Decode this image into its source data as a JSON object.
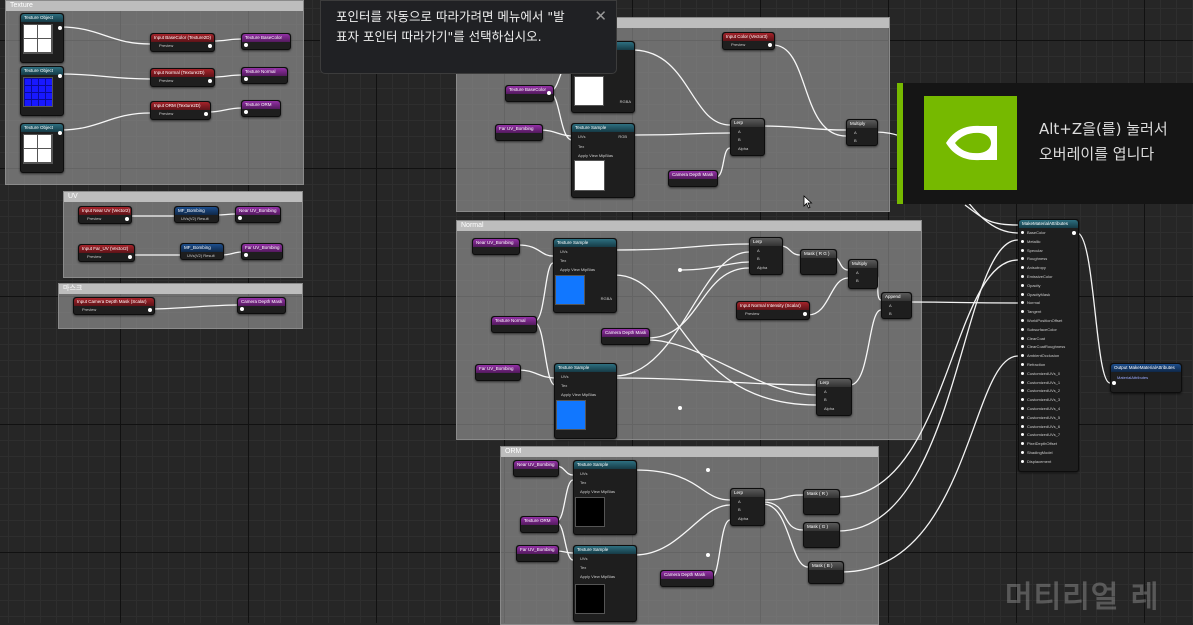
{
  "tooltip": {
    "line1": "포인터를 자동으로 따라가려면 메뉴에서 \"발",
    "line2": "표자 포인터 따라가기\"를 선택하십시오.",
    "close_label": "✕"
  },
  "overlay": {
    "line1": "Alt+Z을(를) 눌러서",
    "line2": "오버레이를 엽니다",
    "accent": "#76b900"
  },
  "watermark": "머티리얼 레",
  "comments": {
    "texture": "Texture",
    "uv": "UV",
    "mask": "마스크",
    "normal": "Normal",
    "orm": "ORM"
  },
  "nodes": {
    "tobj1": {
      "title": "Texture Object"
    },
    "tobj2": {
      "title": "Texture Object"
    },
    "tobj3": {
      "title": "Texture Object"
    },
    "in_basecolor": {
      "title": "Input BaseColor (Texture2D)",
      "pin": "Preview"
    },
    "in_normal": {
      "title": "Input Normal (Texture2D)",
      "pin": "Preview"
    },
    "in_orm": {
      "title": "Input ORM (Texture2D)",
      "pin": "Preview"
    },
    "out_basecolor": {
      "title": "Texture BaseColor"
    },
    "out_normal": {
      "title": "Texture Normal"
    },
    "out_orm": {
      "title": "Texture ORM"
    },
    "in_near_uv": {
      "title": "Input Near UV (Vector2)",
      "pin": "Preview"
    },
    "in_far_uv": {
      "title": "Input Far_UV (Vector2)",
      "pin": "Preview"
    },
    "uvb1": {
      "title": "MF_Bombing",
      "pin": "UVs(V2) Result"
    },
    "uvb2": {
      "title": "MF_Bombing",
      "pin": "UVs(V2) Result"
    },
    "out_near_uv": {
      "title": "Near UV_Bombing"
    },
    "out_far_uv": {
      "title": "Far UV_Bombing"
    },
    "in_cam_mask": {
      "title": "Input Camera Depth Mask (Scalar)",
      "pin": "Preview"
    },
    "out_cam_mask": {
      "title": "Camera Depth Mask"
    },
    "base_tex_basecolor": {
      "title": "Texture BaseColor"
    },
    "base_far_uv": {
      "title": "Far UV_Bombing"
    },
    "base_ts2": {
      "title": "Texture Sample"
    },
    "base_in_color": {
      "title": "Input Color (Vector3)",
      "pin": "Preview"
    },
    "base_lerp": {
      "title": "Lerp"
    },
    "base_multiply": {
      "title": "Multiply"
    },
    "base_cam_mask": {
      "title": "Camera Depth Mask"
    },
    "n_near_uv": {
      "title": "Near UV_Bombing"
    },
    "n_ts1": {
      "title": "Texture Sample"
    },
    "n_tex_normal": {
      "title": "Texture Normal"
    },
    "n_far_uv": {
      "title": "Far UV_Bombing"
    },
    "n_ts2": {
      "title": "Texture Sample"
    },
    "n_cam_mask": {
      "title": "Camera Depth Mask"
    },
    "n_lerp1": {
      "title": "Lerp"
    },
    "n_mask": {
      "title": "Mask ( R G )"
    },
    "n_multiply": {
      "title": "Multiply"
    },
    "n_intensity": {
      "title": "Input Normal Intensity (Scalar)",
      "pin": "Preview"
    },
    "n_append": {
      "title": "Append"
    },
    "n_lerp2": {
      "title": "Lerp"
    },
    "o_near_uv": {
      "title": "Near UV_Bombing"
    },
    "o_ts1": {
      "title": "Texture Sample"
    },
    "o_tex_orm": {
      "title": "Texture ORM"
    },
    "o_far_uv": {
      "title": "Far UV_Bombing"
    },
    "o_ts2": {
      "title": "Texture Sample"
    },
    "o_cam_mask": {
      "title": "Camera Depth Mask"
    },
    "o_lerp": {
      "title": "Lerp"
    },
    "o_mask_r": {
      "title": "Mask ( R )"
    },
    "o_mask_g": {
      "title": "Mask ( G )"
    },
    "o_mask_b": {
      "title": "Mask ( B )"
    },
    "make_attr": {
      "title": "MakeMaterialAttributes"
    },
    "output": {
      "title": "Output MakeMaterialAttributes",
      "pin": "MaterialAttributes"
    }
  },
  "ts_pins": [
    "UVs",
    "Tex",
    "Apply View MipBias",
    "RGB",
    "R",
    "G",
    "B",
    "A",
    "RGBA"
  ],
  "lerp_pins": [
    "A",
    "B",
    "Alpha"
  ],
  "multiply_pins": [
    "A",
    "B"
  ],
  "make_attr_pins": [
    "BaseColor",
    "Metallic",
    "Specular",
    "Roughness",
    "Anisotropy",
    "EmissiveColor",
    "Opacity",
    "OpacityMask",
    "Normal",
    "Tangent",
    "WorldPositionOffset",
    "SubsurfaceColor",
    "ClearCoat",
    "ClearCoatRoughness",
    "AmbientOcclusion",
    "Refraction",
    "CustomizedUVs_0",
    "CustomizedUVs_1",
    "CustomizedUVs_2",
    "CustomizedUVs_3",
    "CustomizedUVs_4",
    "CustomizedUVs_5",
    "CustomizedUVs_6",
    "CustomizedUVs_7",
    "PixelDepthOffset",
    "ShadingModel",
    "Displacement"
  ],
  "colors": {
    "pin_r": "#e03030",
    "pin_g": "#30c030",
    "pin_b": "#3060ff",
    "pin_a": "#bbbbbb"
  }
}
